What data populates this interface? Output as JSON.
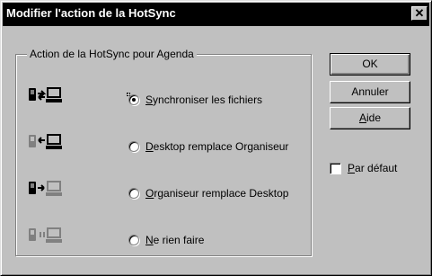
{
  "window": {
    "title": "Modifier l'action de la HotSync",
    "close_glyph": "✕"
  },
  "group": {
    "legend": "Action de la HotSync pour Agenda"
  },
  "options": [
    {
      "pre": "",
      "key": "S",
      "post": "ynchroniser les fichiers",
      "checked": true,
      "icon": "sync-both-icon"
    },
    {
      "pre": "",
      "key": "D",
      "post": "esktop remplace Organiseur",
      "checked": false,
      "icon": "desktop-to-handheld-icon"
    },
    {
      "pre": "",
      "key": "O",
      "post": "rganiseur remplace Desktop",
      "checked": false,
      "icon": "handheld-to-desktop-icon"
    },
    {
      "pre": "",
      "key": "N",
      "post": "e rien faire",
      "checked": false,
      "icon": "do-nothing-icon"
    }
  ],
  "buttons": {
    "ok": "OK",
    "cancel": "Annuler",
    "help_key": "A",
    "help_rest": "ide"
  },
  "default_checkbox": {
    "key": "P",
    "rest": "ar défaut",
    "checked": false
  }
}
